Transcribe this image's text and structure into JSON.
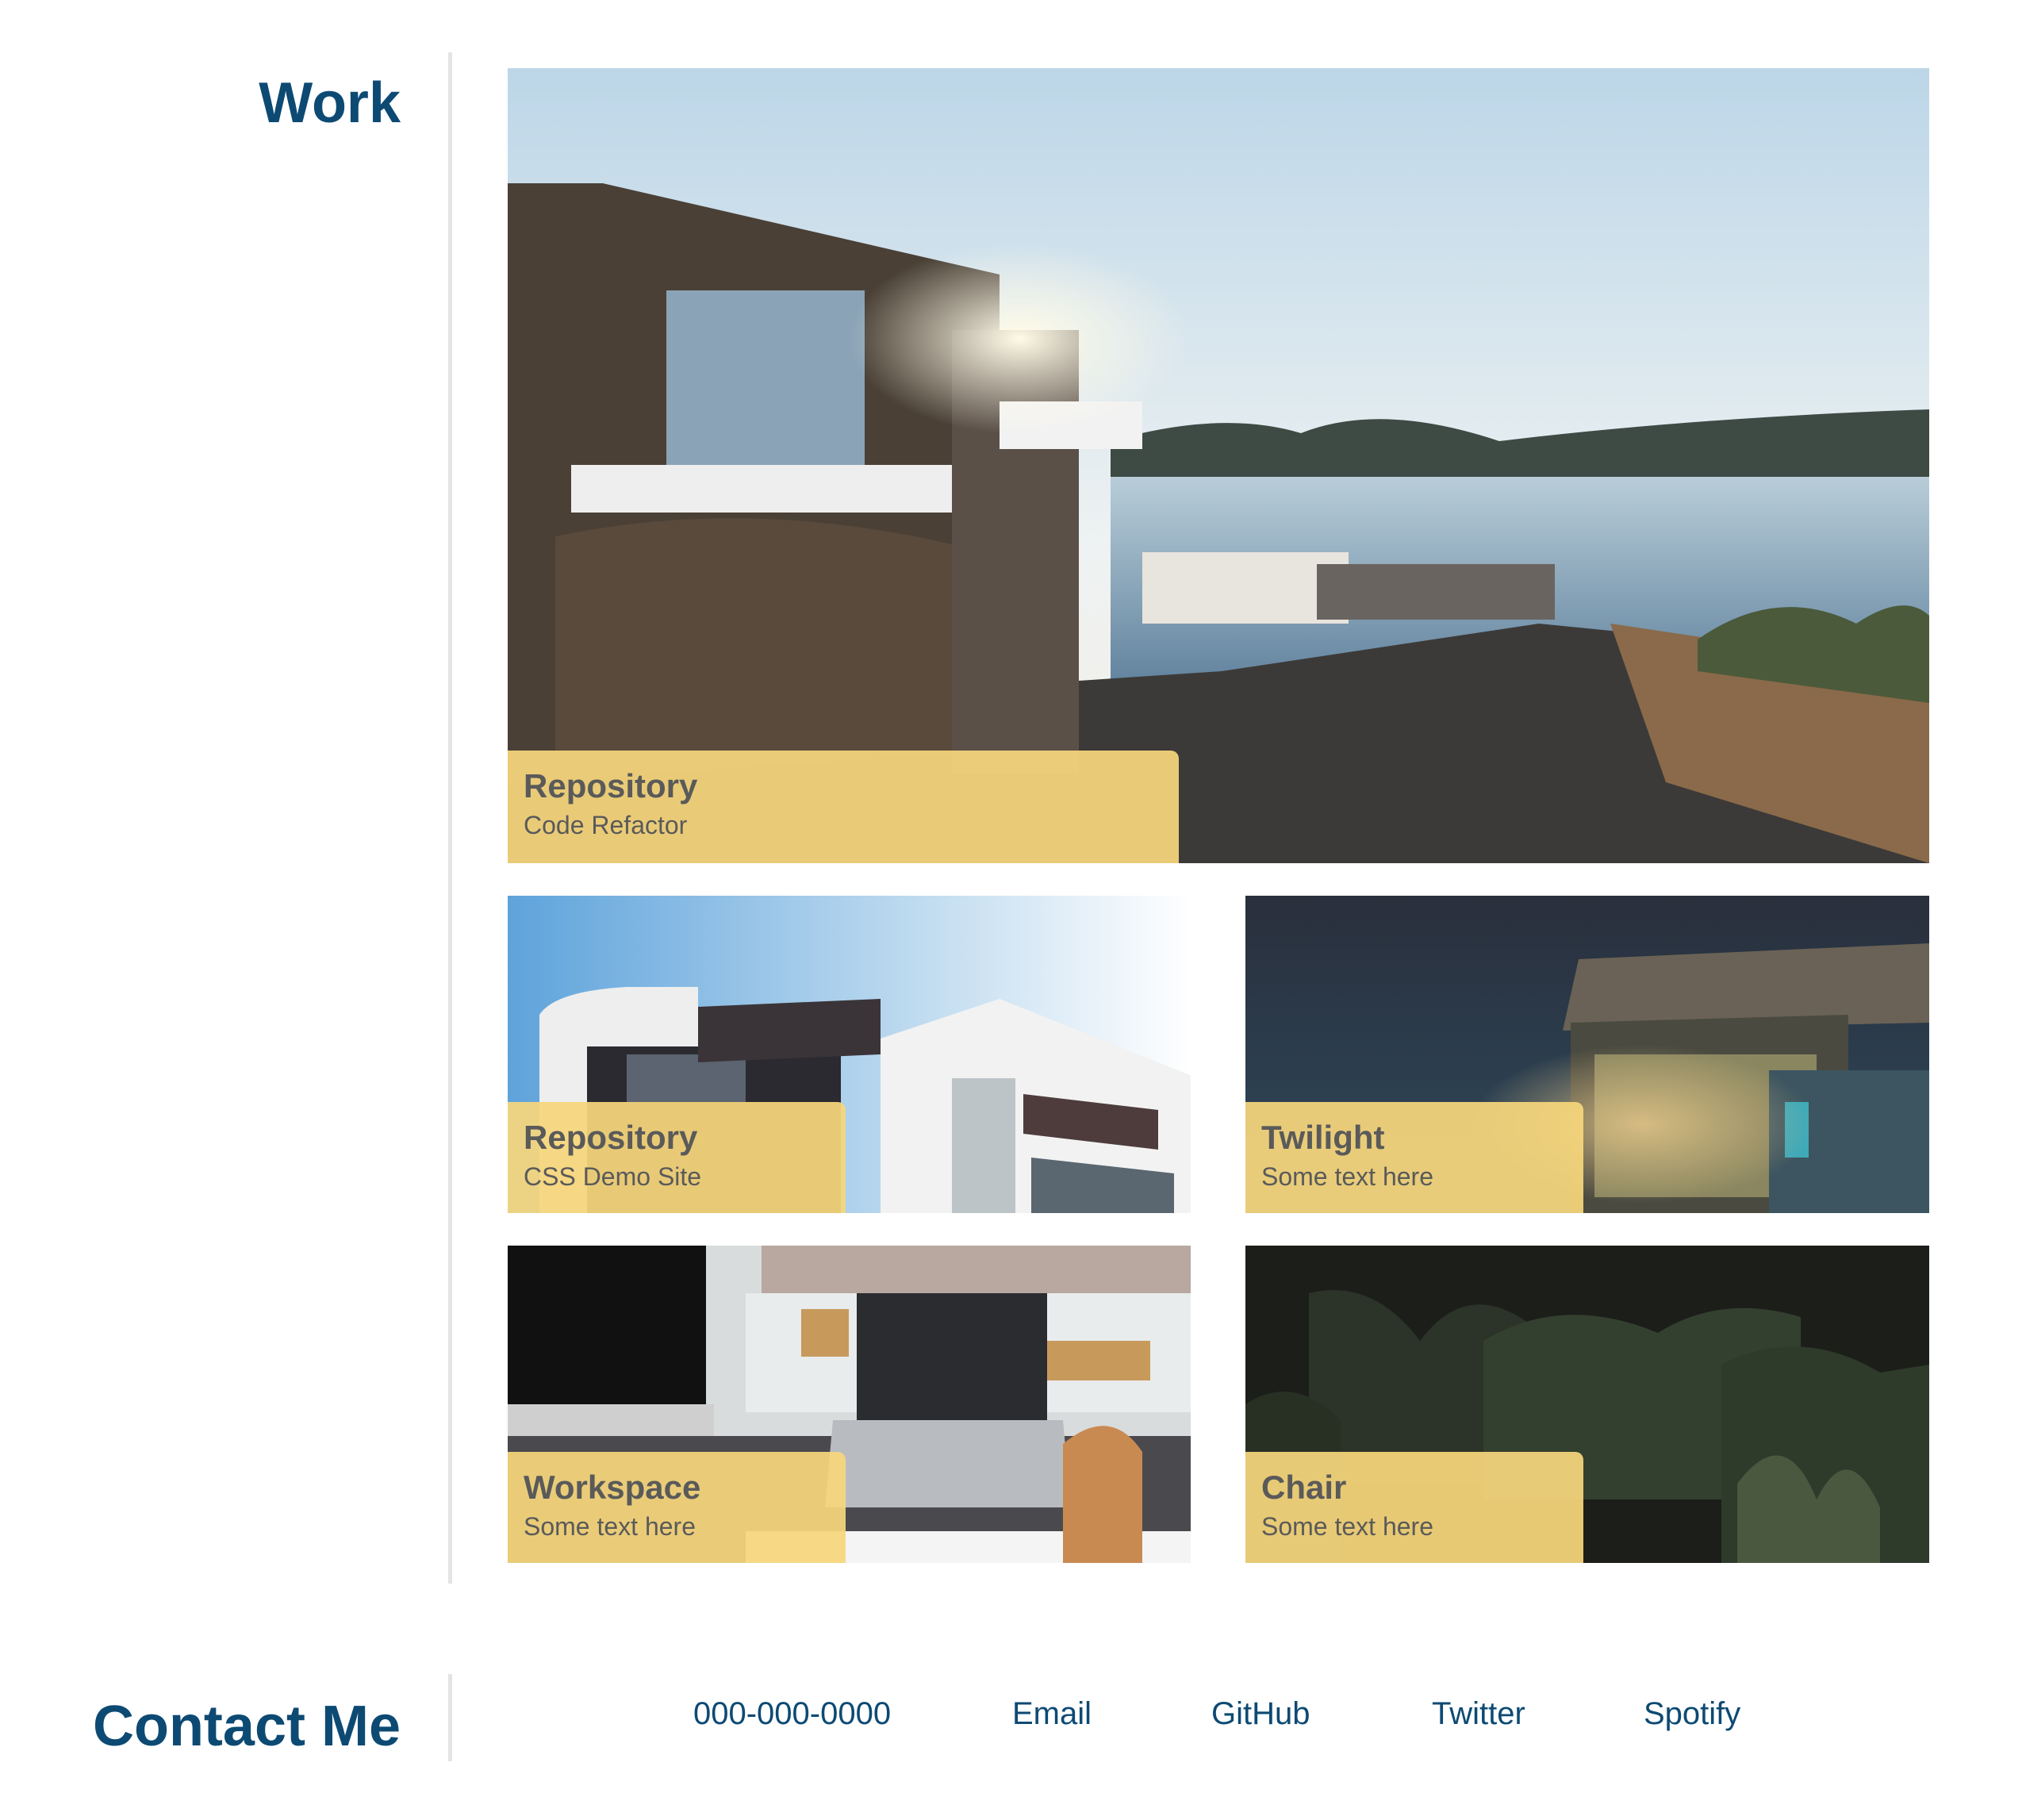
{
  "sections": {
    "work": {
      "title": "Work"
    },
    "contact": {
      "title": "Contact Me"
    }
  },
  "work_cards": [
    {
      "title": "Repository",
      "subtitle": "Code Refactor",
      "image": "seaside-stone-villa-photo"
    },
    {
      "title": "Repository",
      "subtitle": "CSS Demo Site",
      "image": "modern-white-building-photo"
    },
    {
      "title": "Twilight",
      "subtitle": "Some text here",
      "image": "night-pergola-house-photo"
    },
    {
      "title": "Workspace",
      "subtitle": "Some text here",
      "image": "desk-laptop-photo"
    },
    {
      "title": "Chair",
      "subtitle": "Some text here",
      "image": "dark-palm-plants-photo"
    }
  ],
  "contact_links": [
    {
      "label": "000-000-0000"
    },
    {
      "label": "Email"
    },
    {
      "label": "GitHub"
    },
    {
      "label": "Twitter"
    },
    {
      "label": "Spotify"
    }
  ],
  "colors": {
    "heading": "#0d4a73",
    "link": "#0d4a73",
    "caption_bg": "#f6d67c",
    "caption_text": "#5a5a5a",
    "divider": "#e4e4e4"
  }
}
